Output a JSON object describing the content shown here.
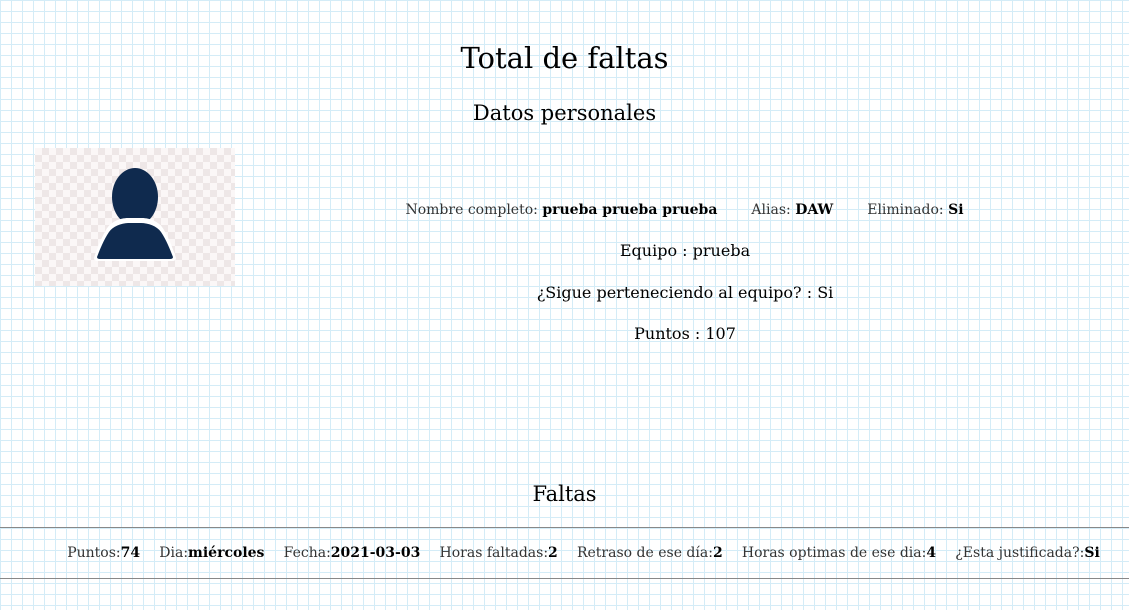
{
  "page": {
    "title": "Total de faltas"
  },
  "datos": {
    "heading": "Datos personales",
    "avatar_icon": "user-silhouette-icon",
    "avatar_color": "#0f2a4e",
    "nombre_label": "Nombre completo:",
    "nombre_value": "prueba prueba prueba",
    "alias_label": "Alias:",
    "alias_value": "DAW",
    "eliminado_label": "Eliminado:",
    "eliminado_value": "Si",
    "equipo": "Equipo : prueba",
    "sigue": "¿Sigue perteneciendo al equipo? : Si",
    "puntos": "Puntos : 107"
  },
  "faltas": {
    "heading": "Faltas",
    "rows": [
      {
        "puntos_label": "Puntos:",
        "puntos_value": "74",
        "dia_label": "Dia:",
        "dia_value": "miércoles",
        "fecha_label": "Fecha:",
        "fecha_value": "2021-03-03",
        "horas_label": "Horas faltadas:",
        "horas_value": "2",
        "retraso_label": "Retraso de ese día:",
        "retraso_value": "2",
        "optimas_label": "Horas optimas de ese dia:",
        "optimas_value": "4",
        "justificada_label": "¿Esta justificada?:",
        "justificada_value": "Si"
      }
    ]
  }
}
